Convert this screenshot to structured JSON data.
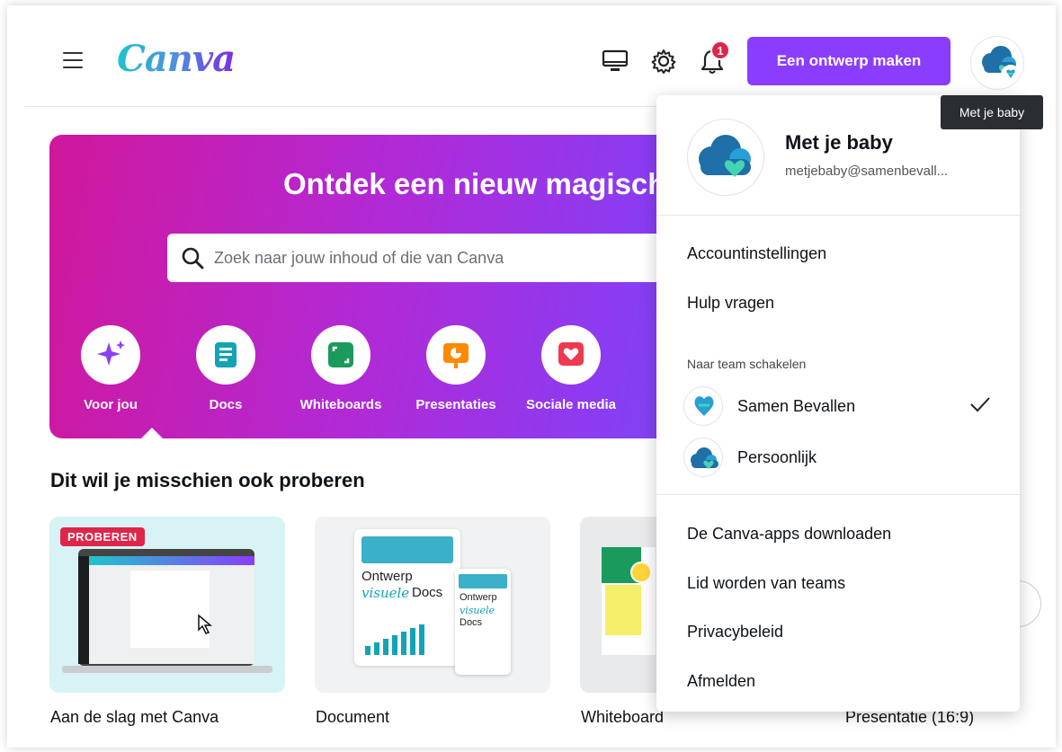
{
  "header": {
    "logo": "Canva",
    "create_button": "Een ontwerp maken",
    "notification_count": "1",
    "tooltip": "Met je baby"
  },
  "hero": {
    "title": "Ontdek een nieuw magisch",
    "search_placeholder": "Zoek naar jouw inhoud of die van Canva",
    "categories": [
      {
        "label": "Voor jou",
        "icon": "sparkle-icon",
        "color": "#8b3dff"
      },
      {
        "label": "Docs",
        "icon": "doc-icon",
        "color": "#13a3b5"
      },
      {
        "label": "Whiteboards",
        "icon": "whiteboard-icon",
        "color": "#1a9a5c"
      },
      {
        "label": "Presentaties",
        "icon": "presentation-icon",
        "color": "#ff8a00"
      },
      {
        "label": "Sociale media",
        "icon": "heart-icon",
        "color": "#f0384f"
      }
    ]
  },
  "section": {
    "title": "Dit wil je misschien ook proberen",
    "cards": [
      {
        "label": "Aan de slag met Canva",
        "badge": "PROBEREN"
      },
      {
        "label": "Document",
        "doc_title_line1": "Ontwerp",
        "doc_title_line2": "visuele",
        "doc_title_line3": "Docs"
      },
      {
        "label": "Whiteboard"
      },
      {
        "label": "Presentatie (16:9)"
      }
    ]
  },
  "menu": {
    "user_name": "Met je baby",
    "user_email": "metjebaby@samenbevall...",
    "items_top": [
      "Accountinstellingen",
      "Hulp vragen"
    ],
    "team_heading": "Naar team schakelen",
    "teams": [
      {
        "name": "Samen Bevallen",
        "selected": true
      },
      {
        "name": "Persoonlijk",
        "selected": false
      }
    ],
    "items_bottom": [
      "De Canva-apps downloaden",
      "Lid worden van teams",
      "Privacybeleid",
      "Afmelden"
    ]
  },
  "colors": {
    "brand_purple": "#8b3dff",
    "badge_red": "#e0254a"
  }
}
